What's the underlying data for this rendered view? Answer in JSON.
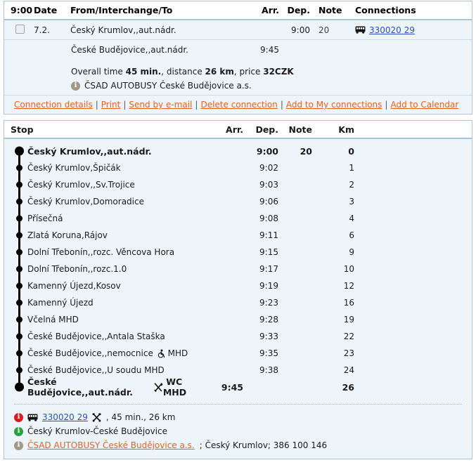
{
  "connection": {
    "headers": {
      "time": "9:00",
      "date": "Date",
      "from": "From/Interchange/To",
      "arr": "Arr.",
      "dep": "Dep.",
      "note": "Note",
      "connections": "Connections"
    },
    "row": {
      "date": "7.2.",
      "from_stop": "Český Krumlov,,aut.nádr.",
      "from_arr": "",
      "from_dep": "9:00",
      "note": "20",
      "line_number": "330020 29",
      "to_stop": "České Budějovice,,aut.nádr.",
      "to_arr": "9:45"
    },
    "summary": {
      "prefix": "Overall time ",
      "time": "45 min.",
      "mid1": ", distance ",
      "distance": "26 km",
      "mid2": ", price ",
      "price": "32CZK"
    },
    "carrier": "ČSAD AUTOBUSY České Budějovice a.s.",
    "links": [
      "Connection details",
      "Print",
      "Send by e-mail",
      "Delete connection",
      "Add to My connections",
      "Add to Calendar"
    ],
    "link_separator": "|"
  },
  "stops": {
    "headers": {
      "stop": "Stop",
      "arr": "Arr.",
      "dep": "Dep.",
      "note": "Note",
      "km": "Km"
    },
    "rows": [
      {
        "name": "Český Krumlov,,aut.nádr.",
        "arr": "",
        "dep": "9:00",
        "note": "20",
        "km": "0",
        "terminus": true,
        "icons": []
      },
      {
        "name": "Český Krumlov,Špičák",
        "arr": "",
        "dep": "9:02",
        "note": "",
        "km": "1",
        "terminus": false,
        "icons": []
      },
      {
        "name": "Český Krumlov,,Sv.Trojice",
        "arr": "",
        "dep": "9:03",
        "note": "",
        "km": "2",
        "terminus": false,
        "icons": []
      },
      {
        "name": "Český Krumlov,Domoradice",
        "arr": "",
        "dep": "9:06",
        "note": "",
        "km": "3",
        "terminus": false,
        "icons": []
      },
      {
        "name": "Přísečná",
        "arr": "",
        "dep": "9:08",
        "note": "",
        "km": "4",
        "terminus": false,
        "icons": []
      },
      {
        "name": "Zlatá Koruna,Rájov",
        "arr": "",
        "dep": "9:11",
        "note": "",
        "km": "6",
        "terminus": false,
        "icons": []
      },
      {
        "name": "Dolní Třebonín,,rozc. Věncova Hora",
        "arr": "",
        "dep": "9:15",
        "note": "",
        "km": "9",
        "terminus": false,
        "icons": []
      },
      {
        "name": "Dolní Třebonín,,rozc.1.0",
        "arr": "",
        "dep": "9:17",
        "note": "",
        "km": "10",
        "terminus": false,
        "icons": []
      },
      {
        "name": "Kamenný Újezd,Kosov",
        "arr": "",
        "dep": "9:19",
        "note": "",
        "km": "12",
        "terminus": false,
        "icons": []
      },
      {
        "name": "Kamenný Újezd",
        "arr": "",
        "dep": "9:23",
        "note": "",
        "km": "16",
        "terminus": false,
        "icons": []
      },
      {
        "name": "Včelná MHD",
        "arr": "",
        "dep": "9:28",
        "note": "",
        "km": "19",
        "terminus": false,
        "icons": []
      },
      {
        "name": "České Budějovice,,Antala Staška",
        "arr": "",
        "dep": "9:33",
        "note": "",
        "km": "22",
        "terminus": false,
        "icons": []
      },
      {
        "name": "České Budějovice,,nemocnice",
        "suffix": "MHD",
        "arr": "",
        "dep": "9:35",
        "note": "",
        "km": "23",
        "terminus": false,
        "icons": [
          "wheelchair-icon"
        ]
      },
      {
        "name": "České Budějovice,,U soudu MHD",
        "arr": "",
        "dep": "9:38",
        "note": "",
        "km": "24",
        "terminus": false,
        "icons": []
      },
      {
        "name": "České Budějovice,,aut.nádr.",
        "suffix": "WC MHD",
        "arr": "9:45",
        "dep": "",
        "note": "",
        "km": "26",
        "terminus": true,
        "icons": [
          "restaurant-icon"
        ]
      }
    ],
    "footer": [
      {
        "marker": "red",
        "icon": "bus-icon",
        "link": "330020 29",
        "extra_icon": "works-icon",
        "text": ", 45 min., 26 km"
      },
      {
        "marker": "green",
        "icon": "",
        "link": "",
        "extra_icon": "",
        "text": "Český Krumlov-České Budějovice"
      },
      {
        "marker": "grey",
        "icon": "",
        "link": "ČSAD AUTOBUSY České Budějovice a.s.",
        "extra_icon": "",
        "text": "; Český Krumlov; 386 100 146"
      }
    ]
  },
  "colors": {
    "link_orange": "#e8601c",
    "link_blue": "#2a4fc4",
    "panel_bg": "#edf5fa",
    "panel_border": "#a9c6d8",
    "marker_red": "#d02020",
    "marker_green": "#24a340",
    "marker_grey": "#a39887"
  }
}
